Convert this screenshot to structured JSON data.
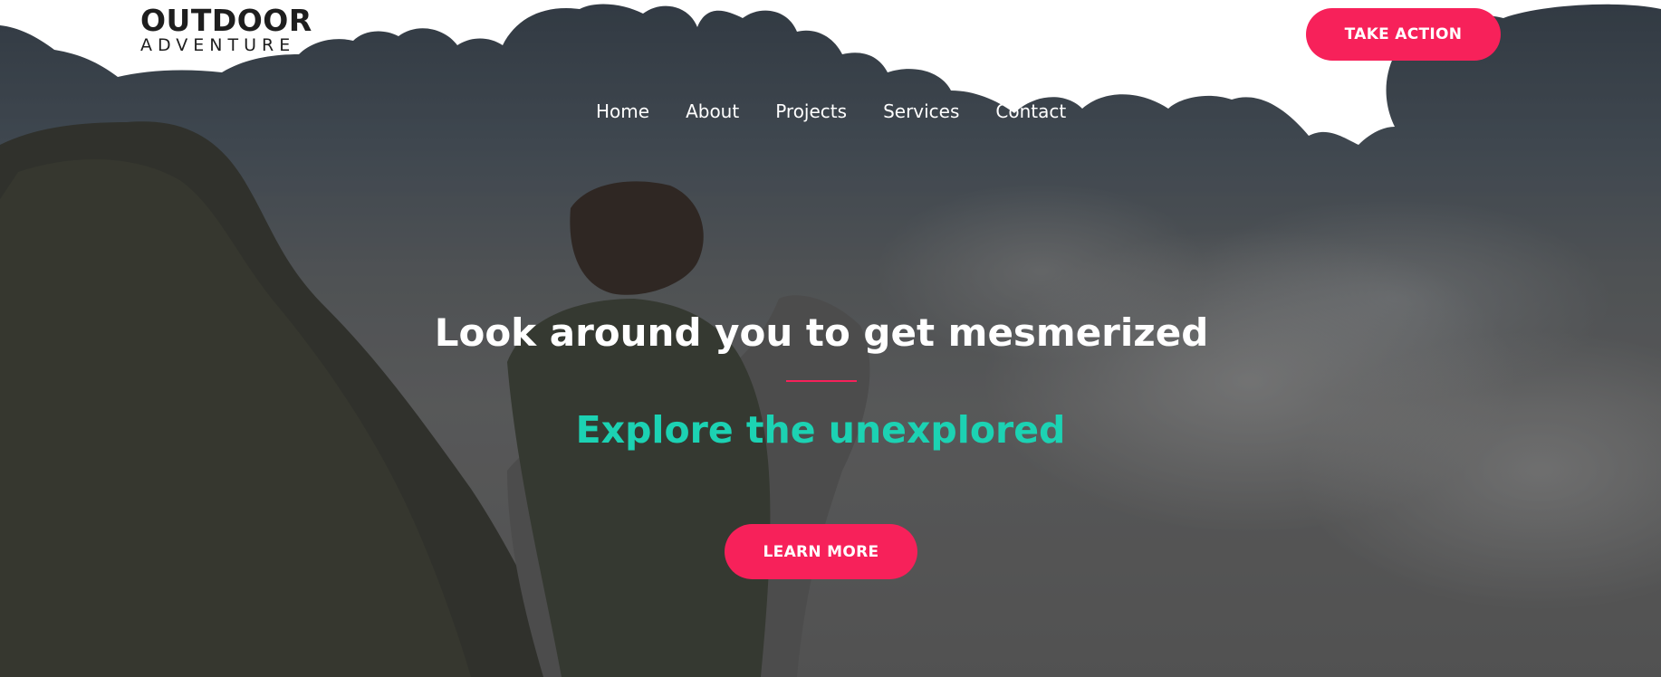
{
  "header": {
    "logo_line1": "OUTDOOR",
    "logo_line2": "ADVENTURE",
    "cta_label": "TAKE ACTION"
  },
  "nav": {
    "items": [
      {
        "label": "Home"
      },
      {
        "label": "About"
      },
      {
        "label": "Projects"
      },
      {
        "label": "Services"
      },
      {
        "label": "Contact"
      }
    ]
  },
  "hero": {
    "headline": "Look around you to get mesmerized",
    "subheadline": "Explore the unexplored",
    "button_label": "LEARN MORE",
    "image_description_icon": "photo-woman-with-husky-on-mountain"
  },
  "colors": {
    "accent_pink": "#f7215a",
    "accent_teal": "#1cd2b3",
    "text_white": "#ffffff",
    "logo_dark": "#1e1e1e"
  }
}
